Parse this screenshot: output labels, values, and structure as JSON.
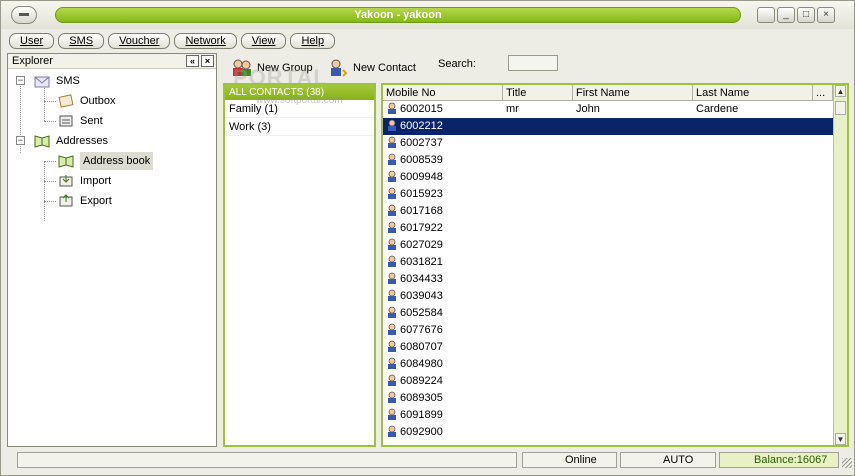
{
  "window": {
    "title": "Yakoon - yakoon",
    "controls": [
      "_",
      "□",
      "×"
    ]
  },
  "menu": {
    "items": [
      "User",
      "SMS",
      "Voucher",
      "Network",
      "View",
      "Help"
    ]
  },
  "explorer": {
    "title": "Explorer",
    "collapse_label": "«",
    "close_label": "×",
    "tree": {
      "sms": "SMS",
      "outbox": "Outbox",
      "sent": "Sent",
      "addresses": "Addresses",
      "address_book": "Address book",
      "import": "Import",
      "export": "Export"
    }
  },
  "toolbar": {
    "new_group": "New Group",
    "new_contact": "New Contact",
    "search_label": "Search:",
    "search_value": ""
  },
  "watermark": {
    "big": "PORTAL",
    "small": "www.softportal.com"
  },
  "groups": {
    "header": "ALL CONTACTS (38)",
    "items": [
      "Family (1)",
      "Work (3)"
    ]
  },
  "contacts": {
    "columns": [
      "Mobile No",
      "Title",
      "First Name",
      "Last Name",
      "..."
    ],
    "rows": [
      {
        "mobile": "6002015",
        "title": "mr",
        "first": "John",
        "last": "Cardene"
      },
      {
        "mobile": "6002212",
        "title": "",
        "first": "",
        "last": ""
      },
      {
        "mobile": "6002737",
        "title": "",
        "first": "",
        "last": ""
      },
      {
        "mobile": "6008539",
        "title": "",
        "first": "",
        "last": ""
      },
      {
        "mobile": "6009948",
        "title": "",
        "first": "",
        "last": ""
      },
      {
        "mobile": "6015923",
        "title": "",
        "first": "",
        "last": ""
      },
      {
        "mobile": "6017168",
        "title": "",
        "first": "",
        "last": ""
      },
      {
        "mobile": "6017922",
        "title": "",
        "first": "",
        "last": ""
      },
      {
        "mobile": "6027029",
        "title": "",
        "first": "",
        "last": ""
      },
      {
        "mobile": "6031821",
        "title": "",
        "first": "",
        "last": ""
      },
      {
        "mobile": "6034433",
        "title": "",
        "first": "",
        "last": ""
      },
      {
        "mobile": "6039043",
        "title": "",
        "first": "",
        "last": ""
      },
      {
        "mobile": "6052584",
        "title": "",
        "first": "",
        "last": ""
      },
      {
        "mobile": "6077676",
        "title": "",
        "first": "",
        "last": ""
      },
      {
        "mobile": "6080707",
        "title": "",
        "first": "",
        "last": ""
      },
      {
        "mobile": "6084980",
        "title": "",
        "first": "",
        "last": ""
      },
      {
        "mobile": "6089224",
        "title": "",
        "first": "",
        "last": ""
      },
      {
        "mobile": "6089305",
        "title": "",
        "first": "",
        "last": ""
      },
      {
        "mobile": "6091899",
        "title": "",
        "first": "",
        "last": ""
      },
      {
        "mobile": "6092900",
        "title": "",
        "first": "",
        "last": ""
      }
    ],
    "selected_index": 1
  },
  "status": {
    "connection": "Online",
    "mode": "AUTO",
    "balance": "Balance:16067"
  },
  "colors": {
    "accent_green": "#9ec23a",
    "selection": "#0a246a"
  }
}
